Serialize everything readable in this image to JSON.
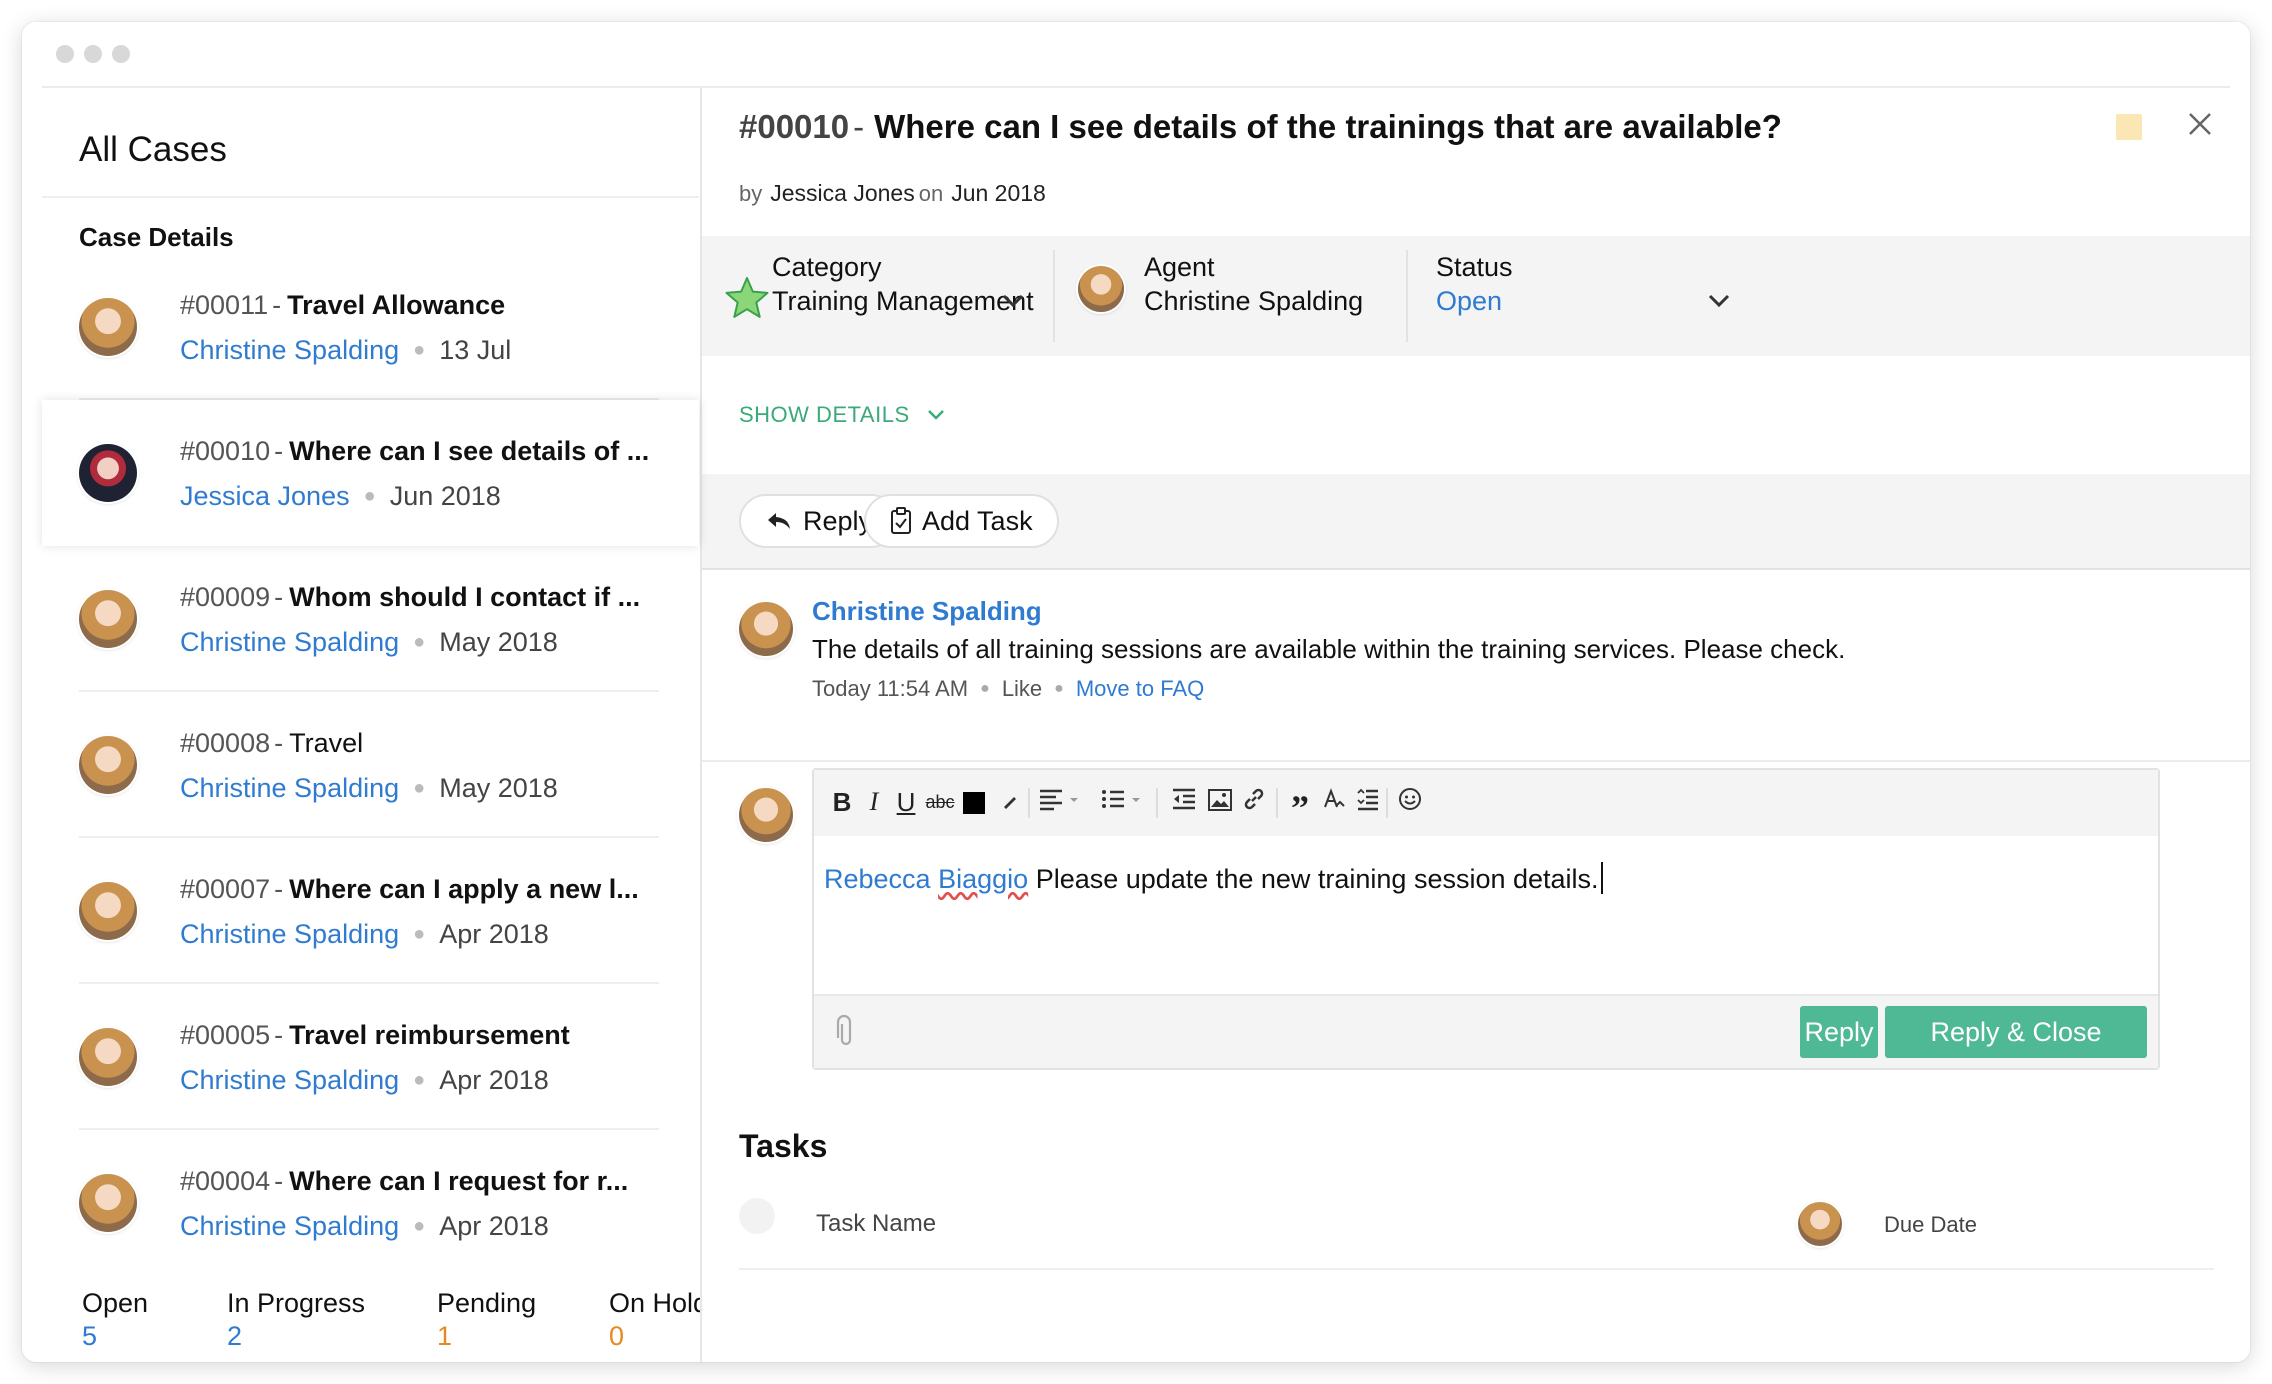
{
  "left": {
    "title": "All Cases",
    "subtitle": "Case Details",
    "cases": [
      {
        "number": "#00011",
        "title": "Travel Allowance",
        "agent": "Christine Spalding",
        "date": "13 Jul"
      },
      {
        "number": "#00010",
        "title": "Where can I see details of ...",
        "agent": "Jessica Jones",
        "date": "Jun 2018"
      },
      {
        "number": "#00009",
        "title": "Whom should I contact if ...",
        "agent": "Christine Spalding",
        "date": "May 2018"
      },
      {
        "number": "#00008",
        "title": "Travel",
        "agent": "Christine Spalding",
        "date": "May 2018"
      },
      {
        "number": "#00007",
        "title": "Where can I apply a new l...",
        "agent": "Christine Spalding",
        "date": "Apr 2018"
      },
      {
        "number": "#00005",
        "title": "Travel reimbursement",
        "agent": "Christine Spalding",
        "date": "Apr 2018"
      },
      {
        "number": "#00004",
        "title": "Where can I request for r...",
        "agent": "Christine Spalding",
        "date": "Apr 2018"
      }
    ],
    "dash": "-",
    "status_counts": [
      {
        "label": "Open",
        "count": "5",
        "color": "#2f7bd0"
      },
      {
        "label": "In Progress",
        "count": "2",
        "color": "#2f7bd0"
      },
      {
        "label": "Pending",
        "count": "1",
        "color": "#e48a1e"
      },
      {
        "label": "On Hold",
        "count": "0",
        "color": "#e48a1e"
      }
    ]
  },
  "detail": {
    "number": "#00010",
    "dash": "-",
    "title": "Where can I see details of the trainings that are available?",
    "by_label": "by",
    "author": "Jessica Jones",
    "on_label": "on",
    "date": "Jun 2018",
    "category": {
      "label": "Category",
      "value": "Training Management"
    },
    "agent": {
      "label": "Agent",
      "value": "Christine Spalding"
    },
    "status": {
      "label": "Status",
      "value": "Open",
      "color": "#2f7bd0"
    },
    "show_details": "SHOW DETAILS",
    "actions": {
      "reply": "Reply",
      "add_task": "Add Task"
    },
    "thread": {
      "author": "Christine Spalding",
      "text": "The details of all training sessions are available within the training services. Please check.",
      "time": "Today 11:54 AM",
      "like": "Like",
      "move_to_faq": "Move to FAQ"
    },
    "editor": {
      "mention_first": "Rebecca",
      "mention_last": "Biaggio",
      "text": "Please update the new training session details.",
      "reply_button": "Reply",
      "reply_close_button": "Reply & Close"
    },
    "tasks": {
      "title": "Tasks",
      "task_name_col": "Task Name",
      "due_date_col": "Due Date"
    }
  },
  "colors": {
    "accent_blue": "#2f7bd0",
    "accent_green": "#4fb894",
    "star_green": "#8cd67a",
    "orange": "#e48a1e"
  },
  "icons": [
    "star-icon",
    "chevron-down-icon",
    "close-icon",
    "reply-icon",
    "clipboard-icon",
    "paperclip-icon",
    "bold-icon",
    "italic-icon",
    "underline-icon",
    "strikethrough-icon",
    "text-color-icon",
    "highlight-icon",
    "align-icon",
    "bullet-list-icon",
    "outdent-icon",
    "image-icon",
    "link-icon",
    "quote-icon",
    "clear-format-icon",
    "line-spacing-icon",
    "emoji-icon"
  ]
}
